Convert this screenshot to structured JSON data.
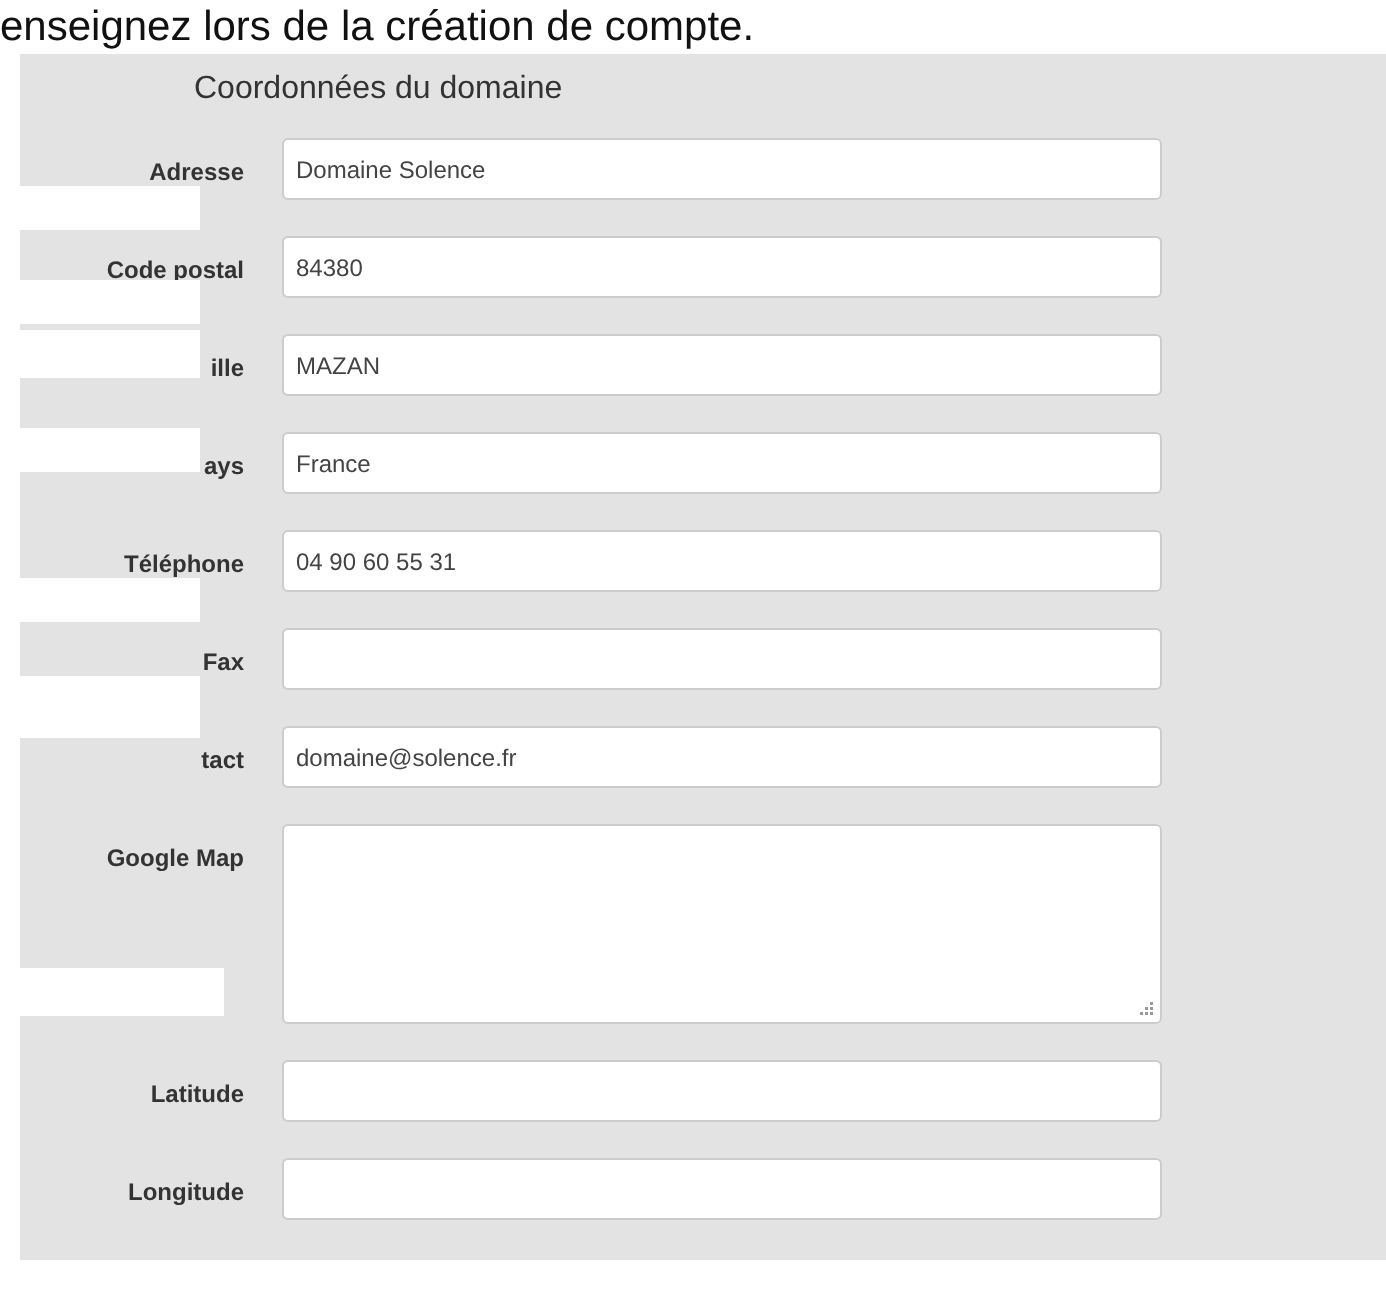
{
  "intro_text": "enseignez lors de la création de compte.",
  "panel": {
    "title": "Coordonnées du domaine",
    "fields": [
      {
        "label": "Adresse",
        "kind": "text",
        "value": "Domaine Solence"
      },
      {
        "label": "Code postal",
        "kind": "text",
        "value": "84380"
      },
      {
        "label": "ille",
        "kind": "text",
        "value": "MAZAN"
      },
      {
        "label": "ays",
        "kind": "text",
        "value": "France"
      },
      {
        "label": "Téléphone",
        "kind": "text",
        "value": "04 90 60 55 31"
      },
      {
        "label": "Fax",
        "kind": "text"
      },
      {
        "label": "tact",
        "kind": "text",
        "value": "domaine@solence.fr"
      },
      {
        "label": "Google Map",
        "kind": "textarea"
      },
      {
        "label": "Latitude",
        "kind": "text"
      },
      {
        "label": "Longitude",
        "kind": "text"
      }
    ]
  }
}
